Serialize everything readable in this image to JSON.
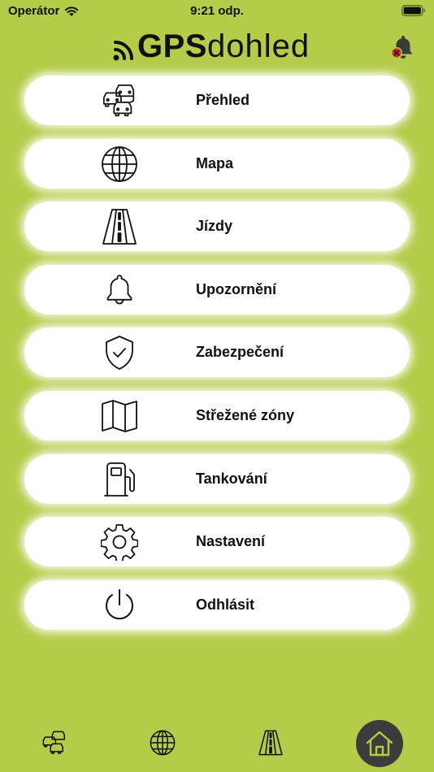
{
  "status_bar": {
    "carrier": "Operátor",
    "time": "9:21 odp."
  },
  "header": {
    "logo_bold": "GPS",
    "logo_light": "dohled",
    "alert_icon": "bell-muted-icon"
  },
  "menu": [
    {
      "label": "Přehled",
      "icon": "cars-icon"
    },
    {
      "label": "Mapa",
      "icon": "globe-icon"
    },
    {
      "label": "Jízdy",
      "icon": "road-icon"
    },
    {
      "label": "Upozornění",
      "icon": "bell-icon"
    },
    {
      "label": "Zabezpečení",
      "icon": "shield-check-icon"
    },
    {
      "label": "Střežené zóny",
      "icon": "map-icon"
    },
    {
      "label": "Tankování",
      "icon": "fuel-pump-icon"
    },
    {
      "label": "Nastavení",
      "icon": "gear-icon"
    },
    {
      "label": "Odhlásit",
      "icon": "power-icon"
    }
  ],
  "tabbar": [
    {
      "icon": "cars-icon"
    },
    {
      "icon": "globe-icon"
    },
    {
      "icon": "road-icon"
    },
    {
      "icon": "home-icon",
      "active": true
    }
  ],
  "colors": {
    "background": "#b5cc4a",
    "button": "#ffffff",
    "home_active": "#3c3c3c",
    "alert_badge": "#d9262c"
  }
}
